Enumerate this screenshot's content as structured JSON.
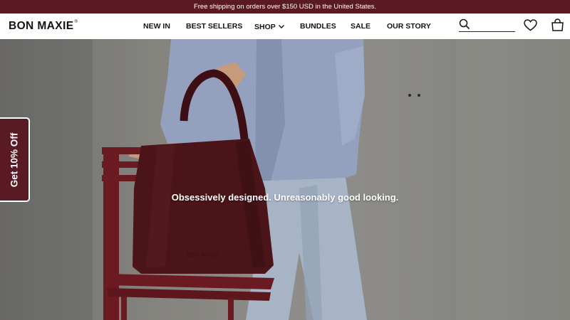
{
  "announcement": "Free shipping on orders over $150 USD in the United States.",
  "brand": {
    "name": "BON MAXIE",
    "mark": "®"
  },
  "nav": [
    {
      "label": "NEW IN"
    },
    {
      "label": "BEST SELLERS"
    },
    {
      "label": "SHOP",
      "has_dropdown": true
    },
    {
      "label": "BUNDLES"
    },
    {
      "label": "SALE"
    },
    {
      "label": "OUR STORY"
    }
  ],
  "header_icons": [
    "search-icon",
    "heart-icon",
    "bag-icon"
  ],
  "search": {
    "value": "",
    "placeholder": ""
  },
  "hero": {
    "tagline": "Obsessively designed. Unreasonably good looking."
  },
  "promo": {
    "label": "Get 10% Off"
  },
  "colors": {
    "brand": "#5a1a24",
    "bag": "#4a1419",
    "chair": "#6b1a22",
    "coat": "#93a0be"
  }
}
